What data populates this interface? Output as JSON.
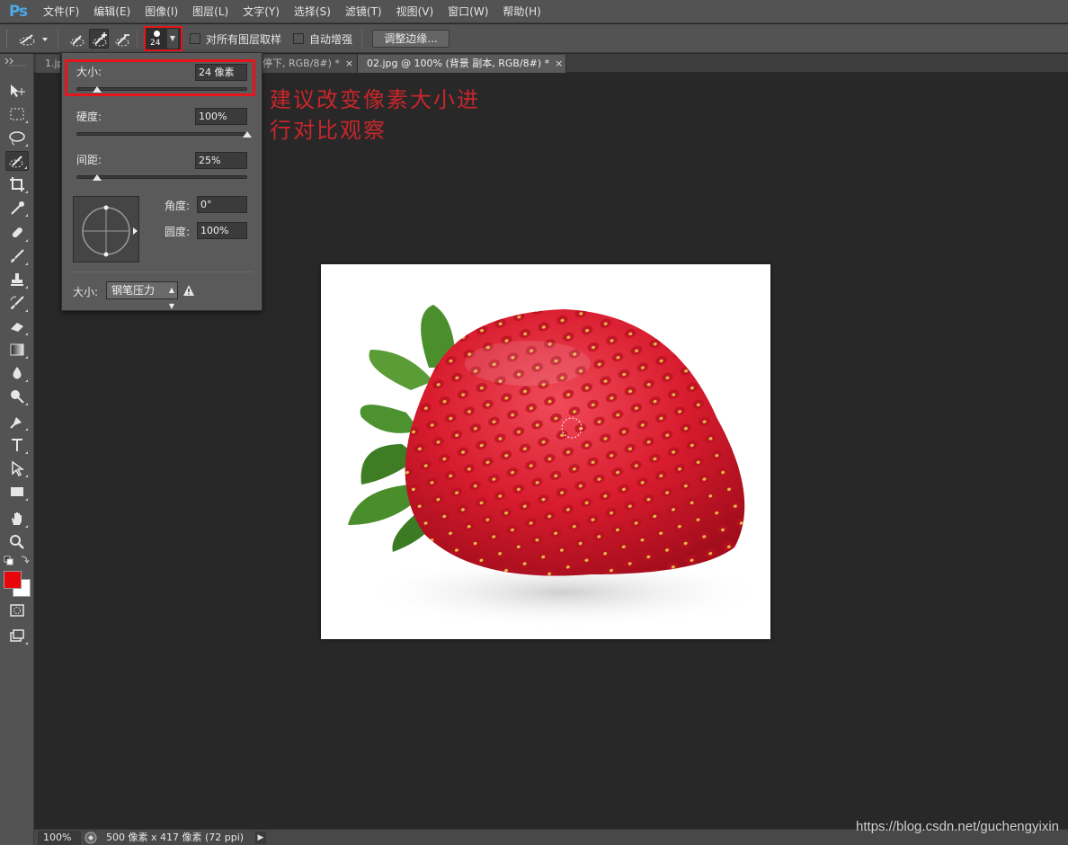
{
  "app": {
    "logo": "Ps"
  },
  "menu": [
    "文件(F)",
    "编辑(E)",
    "图像(I)",
    "图层(L)",
    "文字(Y)",
    "选择(S)",
    "滤镜(T)",
    "视图(V)",
    "窗口(W)",
    "帮助(H)"
  ],
  "options": {
    "brush_size": "24",
    "sample_all_layers": "对所有图层取样",
    "auto_enhance": "自动增强",
    "refine_edge": "调整边缘..."
  },
  "tabs": [
    {
      "label": "1.jp",
      "active": false
    },
    {
      "label": "停下, RGB/8#) *",
      "active": false
    },
    {
      "label": "02.jpg @ 100% (背景 副本, RGB/8#) *",
      "active": true
    }
  ],
  "tab_close": "×",
  "brush_panel": {
    "size_label": "大小:",
    "size_value": "24 像素",
    "size_pct": 0.12,
    "hardness_label": "硬度:",
    "hardness_value": "100%",
    "hardness_pct": 1.0,
    "spacing_label": "间距:",
    "spacing_value": "25%",
    "spacing_pct": 0.12,
    "angle_label": "角度:",
    "angle_value": "0°",
    "roundness_label": "圆度:",
    "roundness_value": "100%",
    "pressure_label": "大小:",
    "pressure_value": "钢笔压力"
  },
  "annotation": [
    "建议改变像素大小进",
    "行对比观察"
  ],
  "colors": {
    "foreground": "#e8060c",
    "background": "#ffffff",
    "highlight": "#e5151b",
    "annotation": "#c8262b"
  },
  "status": {
    "zoom": "100%",
    "doc_info": "500 像素 x 417 像素 (72 ppi)"
  },
  "watermark": "https://blog.csdn.net/guchengyixin"
}
